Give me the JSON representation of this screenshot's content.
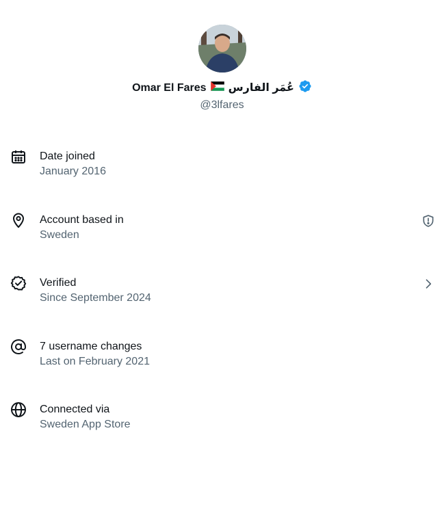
{
  "profile": {
    "name": "Omar El Fares",
    "arabic_name": "عُمَر الفارس",
    "handle": "@3lfares",
    "flag_icon": "palestine-flag-icon",
    "verified_color": "#1d9bf0"
  },
  "rows": [
    {
      "label": "Date joined",
      "value": "January 2016",
      "icon": "calendar-icon"
    },
    {
      "label": "Account based in",
      "value": "Sweden",
      "icon": "location-pin-icon",
      "trail_icon": "shield-alert-icon"
    },
    {
      "label": "Verified",
      "value": "Since September 2024",
      "icon": "verified-seal-icon",
      "trail_icon": "chevron-right-icon"
    },
    {
      "label": "7 username changes",
      "value": "Last on February 2021",
      "icon": "at-sign-icon"
    },
    {
      "label": "Connected via",
      "value": "Sweden App Store",
      "icon": "globe-icon"
    }
  ],
  "colors": {
    "text_primary": "#0f1419",
    "text_secondary": "#536471",
    "verified_blue": "#1d9bf0"
  }
}
